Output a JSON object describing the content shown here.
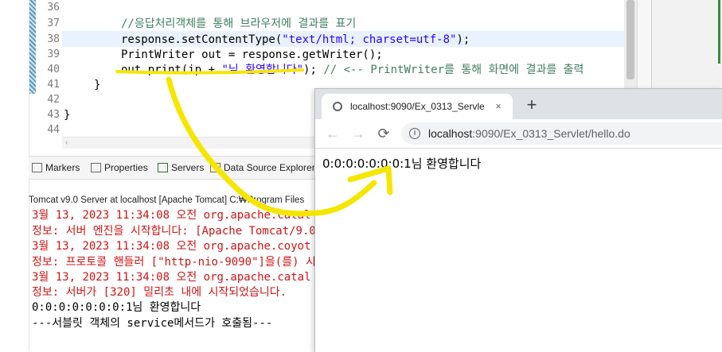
{
  "editor": {
    "lines": [
      {
        "num": "36",
        "html_parts": []
      },
      {
        "num": "37",
        "text": "//응답처리객체를 통해 브라우저에 결과를 표기"
      },
      {
        "num": "38",
        "pre": "response.setContentType(",
        "str": "\"text/html; charset=utf-8\"",
        "post": ");"
      },
      {
        "num": "39",
        "text": "PrintWriter out = response.getWriter();"
      },
      {
        "num": "40",
        "pre": "out.print(ip + ",
        "str": "\"님 환영합니다\"",
        "post": "); ",
        "comment": "// <-- PrintWriter를 통해 화면에 결과를 출력"
      },
      {
        "num": "41",
        "text": "}"
      },
      {
        "num": "42",
        "text": ""
      },
      {
        "num": "43",
        "text": "}"
      },
      {
        "num": "44",
        "text": ""
      }
    ]
  },
  "panel": {
    "tabs": [
      "Markers",
      "Properties",
      "Servers",
      "Data Source Explorer"
    ],
    "console_header": "Tomcat v9.0 Server at localhost [Apache Tomcat] C:₩Program Files",
    "console_lines": [
      {
        "text": "3월 13, 2023 11:34:08 오전 org.apache.catal",
        "color": "red"
      },
      {
        "text": "정보: 서버 엔진을 시작합니다: [Apache Tomcat/9.0.",
        "color": "red"
      },
      {
        "text": "3월 13, 2023 11:34:08 오전 org.apache.coyot",
        "color": "red"
      },
      {
        "text": "정보: 프로토콜 핸들러 [\"http-nio-9090\"]을(를) 시작",
        "color": "red"
      },
      {
        "text": "3월 13, 2023 11:34:08 오전 org.apache.catal",
        "color": "red"
      },
      {
        "text": "정보: 서버가 [320] 밀리초 내에 시작되었습니다.",
        "color": "red"
      },
      {
        "text": "0:0:0:0:0:0:0:1님 환영합니다",
        "color": "black"
      },
      {
        "text": "---서블릿 객체의 service메서드가 호출됨---",
        "color": "black"
      }
    ]
  },
  "browser": {
    "tab_title": "localhost:9090/Ex_0313_Servlet/",
    "tab_close": "×",
    "new_tab": "+",
    "back": "←",
    "forward": "→",
    "reload": "⟳",
    "url_host": "localhost",
    "url_path": ":9090/Ex_0313_Servlet/hello.do",
    "page_text": "0:0:0:0:0:0:0:1님 환영합니다"
  },
  "icons": {
    "globe": "globe-icon",
    "info": "info-icon"
  },
  "colors": {
    "annotation": "#f5e600",
    "keyword": "#7f0055",
    "string": "#2a00ff",
    "comment": "#3f7f5f",
    "console_error": "#d01515"
  }
}
